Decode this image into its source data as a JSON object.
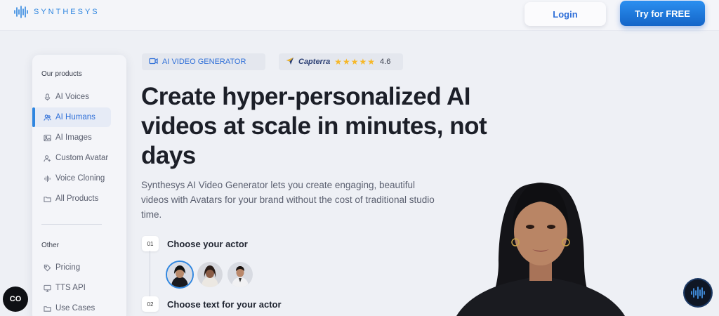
{
  "header": {
    "brand": "SYNTHESYS",
    "login_label": "Login",
    "cta_label": "Try for FREE"
  },
  "sidebar": {
    "section_products": "Our products",
    "products": [
      {
        "label": "AI Voices",
        "icon": "mic-icon",
        "active": false
      },
      {
        "label": "AI Humans",
        "icon": "users-icon",
        "active": true
      },
      {
        "label": "AI Images",
        "icon": "image-icon",
        "active": false
      },
      {
        "label": "Custom Avatar",
        "icon": "user-plus-icon",
        "active": false
      },
      {
        "label": "Voice Cloning",
        "icon": "waveform-icon",
        "active": false
      },
      {
        "label": "All Products",
        "icon": "folder-icon",
        "active": false
      }
    ],
    "section_other": "Other",
    "other": [
      {
        "label": "Pricing",
        "icon": "tag-icon"
      },
      {
        "label": "TTS API",
        "icon": "monitor-icon"
      },
      {
        "label": "Use Cases",
        "icon": "folder-icon"
      }
    ]
  },
  "hero": {
    "badge_generator": "AI VIDEO GENERATOR",
    "badge_capterra": "Capterra",
    "rating": "4.6",
    "stars": "★★★★★",
    "headline": "Create hyper-personalized AI videos at scale in minutes, not days",
    "description": "Synthesys AI Video Generator lets you create engaging, beautiful videos with Avatars for your brand without the cost of traditional studio time."
  },
  "steps": [
    {
      "num": "01",
      "title": "Choose your actor"
    },
    {
      "num": "02",
      "title": "Choose text for your actor"
    }
  ],
  "fab": {
    "left_label": "CO"
  },
  "colors": {
    "accent": "#2f86e0",
    "cta": "#1465c8",
    "background": "#eef0f5"
  }
}
